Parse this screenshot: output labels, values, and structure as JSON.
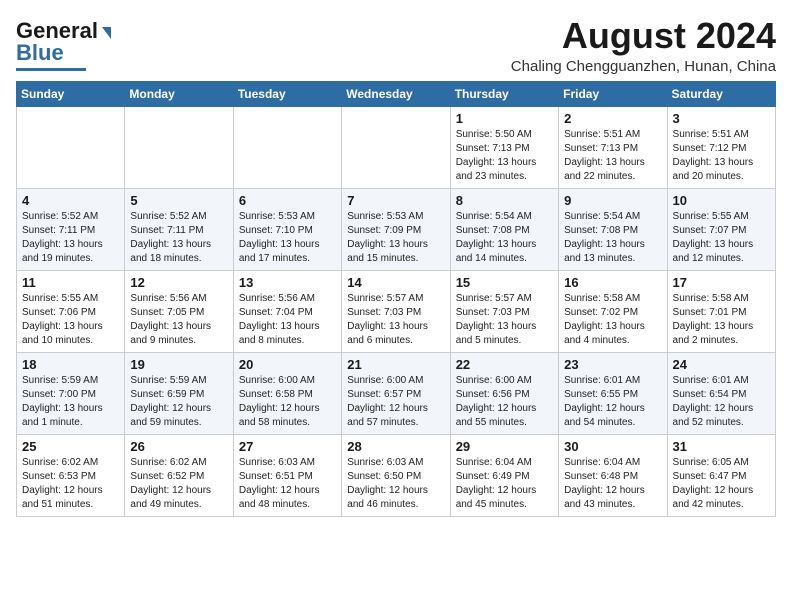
{
  "header": {
    "logo_line1": "General",
    "logo_line2": "Blue",
    "month_year": "August 2024",
    "location": "Chaling Chengguanzhen, Hunan, China"
  },
  "weekdays": [
    "Sunday",
    "Monday",
    "Tuesday",
    "Wednesday",
    "Thursday",
    "Friday",
    "Saturday"
  ],
  "weeks": [
    [
      {
        "day": "",
        "info": ""
      },
      {
        "day": "",
        "info": ""
      },
      {
        "day": "",
        "info": ""
      },
      {
        "day": "",
        "info": ""
      },
      {
        "day": "1",
        "info": "Sunrise: 5:50 AM\nSunset: 7:13 PM\nDaylight: 13 hours\nand 23 minutes."
      },
      {
        "day": "2",
        "info": "Sunrise: 5:51 AM\nSunset: 7:13 PM\nDaylight: 13 hours\nand 22 minutes."
      },
      {
        "day": "3",
        "info": "Sunrise: 5:51 AM\nSunset: 7:12 PM\nDaylight: 13 hours\nand 20 minutes."
      }
    ],
    [
      {
        "day": "4",
        "info": "Sunrise: 5:52 AM\nSunset: 7:11 PM\nDaylight: 13 hours\nand 19 minutes."
      },
      {
        "day": "5",
        "info": "Sunrise: 5:52 AM\nSunset: 7:11 PM\nDaylight: 13 hours\nand 18 minutes."
      },
      {
        "day": "6",
        "info": "Sunrise: 5:53 AM\nSunset: 7:10 PM\nDaylight: 13 hours\nand 17 minutes."
      },
      {
        "day": "7",
        "info": "Sunrise: 5:53 AM\nSunset: 7:09 PM\nDaylight: 13 hours\nand 15 minutes."
      },
      {
        "day": "8",
        "info": "Sunrise: 5:54 AM\nSunset: 7:08 PM\nDaylight: 13 hours\nand 14 minutes."
      },
      {
        "day": "9",
        "info": "Sunrise: 5:54 AM\nSunset: 7:08 PM\nDaylight: 13 hours\nand 13 minutes."
      },
      {
        "day": "10",
        "info": "Sunrise: 5:55 AM\nSunset: 7:07 PM\nDaylight: 13 hours\nand 12 minutes."
      }
    ],
    [
      {
        "day": "11",
        "info": "Sunrise: 5:55 AM\nSunset: 7:06 PM\nDaylight: 13 hours\nand 10 minutes."
      },
      {
        "day": "12",
        "info": "Sunrise: 5:56 AM\nSunset: 7:05 PM\nDaylight: 13 hours\nand 9 minutes."
      },
      {
        "day": "13",
        "info": "Sunrise: 5:56 AM\nSunset: 7:04 PM\nDaylight: 13 hours\nand 8 minutes."
      },
      {
        "day": "14",
        "info": "Sunrise: 5:57 AM\nSunset: 7:03 PM\nDaylight: 13 hours\nand 6 minutes."
      },
      {
        "day": "15",
        "info": "Sunrise: 5:57 AM\nSunset: 7:03 PM\nDaylight: 13 hours\nand 5 minutes."
      },
      {
        "day": "16",
        "info": "Sunrise: 5:58 AM\nSunset: 7:02 PM\nDaylight: 13 hours\nand 4 minutes."
      },
      {
        "day": "17",
        "info": "Sunrise: 5:58 AM\nSunset: 7:01 PM\nDaylight: 13 hours\nand 2 minutes."
      }
    ],
    [
      {
        "day": "18",
        "info": "Sunrise: 5:59 AM\nSunset: 7:00 PM\nDaylight: 13 hours\nand 1 minute."
      },
      {
        "day": "19",
        "info": "Sunrise: 5:59 AM\nSunset: 6:59 PM\nDaylight: 12 hours\nand 59 minutes."
      },
      {
        "day": "20",
        "info": "Sunrise: 6:00 AM\nSunset: 6:58 PM\nDaylight: 12 hours\nand 58 minutes."
      },
      {
        "day": "21",
        "info": "Sunrise: 6:00 AM\nSunset: 6:57 PM\nDaylight: 12 hours\nand 57 minutes."
      },
      {
        "day": "22",
        "info": "Sunrise: 6:00 AM\nSunset: 6:56 PM\nDaylight: 12 hours\nand 55 minutes."
      },
      {
        "day": "23",
        "info": "Sunrise: 6:01 AM\nSunset: 6:55 PM\nDaylight: 12 hours\nand 54 minutes."
      },
      {
        "day": "24",
        "info": "Sunrise: 6:01 AM\nSunset: 6:54 PM\nDaylight: 12 hours\nand 52 minutes."
      }
    ],
    [
      {
        "day": "25",
        "info": "Sunrise: 6:02 AM\nSunset: 6:53 PM\nDaylight: 12 hours\nand 51 minutes."
      },
      {
        "day": "26",
        "info": "Sunrise: 6:02 AM\nSunset: 6:52 PM\nDaylight: 12 hours\nand 49 minutes."
      },
      {
        "day": "27",
        "info": "Sunrise: 6:03 AM\nSunset: 6:51 PM\nDaylight: 12 hours\nand 48 minutes."
      },
      {
        "day": "28",
        "info": "Sunrise: 6:03 AM\nSunset: 6:50 PM\nDaylight: 12 hours\nand 46 minutes."
      },
      {
        "day": "29",
        "info": "Sunrise: 6:04 AM\nSunset: 6:49 PM\nDaylight: 12 hours\nand 45 minutes."
      },
      {
        "day": "30",
        "info": "Sunrise: 6:04 AM\nSunset: 6:48 PM\nDaylight: 12 hours\nand 43 minutes."
      },
      {
        "day": "31",
        "info": "Sunrise: 6:05 AM\nSunset: 6:47 PM\nDaylight: 12 hours\nand 42 minutes."
      }
    ]
  ]
}
